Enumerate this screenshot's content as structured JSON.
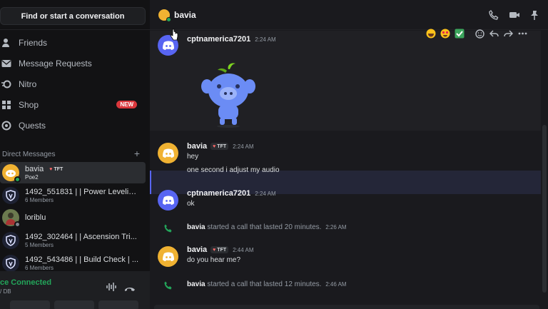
{
  "sidebar": {
    "search_label": "Find or start a conversation",
    "nav": [
      {
        "label": "Friends",
        "icon": "friends-icon"
      },
      {
        "label": "Message Requests",
        "icon": "envelope-icon"
      },
      {
        "label": "Nitro",
        "icon": "nitro-icon"
      },
      {
        "label": "Shop",
        "icon": "shop-icon",
        "badge": "NEW"
      },
      {
        "label": "Quests",
        "icon": "quests-icon"
      }
    ],
    "dm_header": "Direct Messages",
    "dms": [
      {
        "name": "bavia",
        "tag": "TFT",
        "sub": "Poe2",
        "active": true
      },
      {
        "name": "1492_551831 | | Power Leveling ...",
        "sub": "6 Members"
      },
      {
        "name": "loriblu",
        "sub": ""
      },
      {
        "name": "1492_302464 | | Ascension Tri...",
        "sub": "5 Members"
      },
      {
        "name": "1492_543486 | | Build Check | ...",
        "sub": "6 Members"
      }
    ],
    "voice": {
      "status": "ce Connected",
      "sub": "/ DB"
    }
  },
  "header": {
    "title": "bavia"
  },
  "messages": [
    {
      "author": "cptnamerica7201",
      "time": "2:24 AM",
      "text": ""
    },
    {
      "author": "bavia",
      "tag": "TFT",
      "time": "2:24 AM",
      "text": "hey",
      "text2": "one second i adjust my audio"
    },
    {
      "author": "cptnamerica7201",
      "time": "2:24 AM",
      "text": "ok"
    },
    {
      "author": "bavia",
      "tag": "TFT",
      "time": "2:44 AM",
      "text": "do you hear me?"
    }
  ],
  "system": [
    {
      "who": "bavia",
      "text": "started a call that lasted 20 minutes.",
      "time": "2:26 AM"
    },
    {
      "who": "bavia",
      "text": "started a call that lasted 12 minutes.",
      "time": "2:46 AM"
    }
  ],
  "colors": {
    "accent": "#5865f2",
    "online": "#23a55a",
    "call": "#23a55a",
    "danger": "#da373c"
  }
}
